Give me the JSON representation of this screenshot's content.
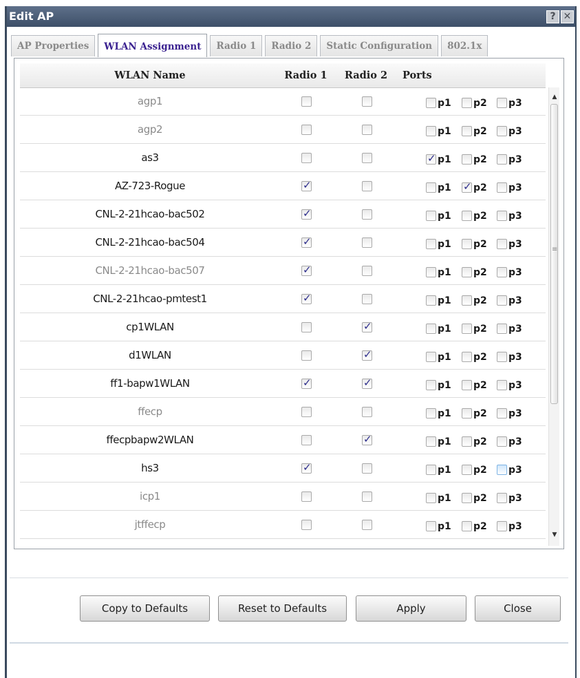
{
  "window": {
    "title": "Edit AP",
    "help_glyph": "?",
    "close_glyph": "✕"
  },
  "tabs": [
    {
      "label": "AP Properties",
      "active": false
    },
    {
      "label": "WLAN Assignment",
      "active": true
    },
    {
      "label": "Radio 1",
      "active": false
    },
    {
      "label": "Radio 2",
      "active": false
    },
    {
      "label": "Static Configuration",
      "active": false
    },
    {
      "label": "802.1x",
      "active": false
    }
  ],
  "grid": {
    "columns": {
      "wlan_name": "WLAN Name",
      "radio1": "Radio 1",
      "radio2": "Radio 2",
      "ports": "Ports"
    },
    "port_labels": [
      "p1",
      "p2",
      "p3"
    ],
    "rows": [
      {
        "name": "agp1",
        "dim": true,
        "radio1": false,
        "radio2": false,
        "ports": [
          false,
          false,
          false
        ]
      },
      {
        "name": "agp2",
        "dim": true,
        "radio1": false,
        "radio2": false,
        "ports": [
          false,
          false,
          false
        ]
      },
      {
        "name": "as3",
        "dim": false,
        "radio1": false,
        "radio2": false,
        "ports": [
          true,
          false,
          false
        ]
      },
      {
        "name": "AZ-723-Rogue",
        "dim": false,
        "radio1": true,
        "radio2": false,
        "ports": [
          false,
          true,
          false
        ]
      },
      {
        "name": "CNL-2-21hcao-bac502",
        "dim": false,
        "radio1": true,
        "radio2": false,
        "ports": [
          false,
          false,
          false
        ]
      },
      {
        "name": "CNL-2-21hcao-bac504",
        "dim": false,
        "radio1": true,
        "radio2": false,
        "ports": [
          false,
          false,
          false
        ]
      },
      {
        "name": "CNL-2-21hcao-bac507",
        "dim": true,
        "radio1": true,
        "radio2": false,
        "ports": [
          false,
          false,
          false
        ]
      },
      {
        "name": "CNL-2-21hcao-pmtest1",
        "dim": false,
        "radio1": true,
        "radio2": false,
        "ports": [
          false,
          false,
          false
        ]
      },
      {
        "name": "cp1WLAN",
        "dim": false,
        "radio1": false,
        "radio2": true,
        "ports": [
          false,
          false,
          false
        ]
      },
      {
        "name": "d1WLAN",
        "dim": false,
        "radio1": false,
        "radio2": true,
        "ports": [
          false,
          false,
          false
        ]
      },
      {
        "name": "ff1-bapw1WLAN",
        "dim": false,
        "radio1": true,
        "radio2": true,
        "ports": [
          false,
          false,
          false
        ]
      },
      {
        "name": "ffecp",
        "dim": true,
        "radio1": false,
        "radio2": false,
        "ports": [
          false,
          false,
          false
        ]
      },
      {
        "name": "ffecpbapw2WLAN",
        "dim": false,
        "radio1": false,
        "radio2": true,
        "ports": [
          false,
          false,
          false
        ]
      },
      {
        "name": "hs3",
        "dim": false,
        "radio1": true,
        "radio2": false,
        "ports": [
          false,
          false,
          false
        ],
        "hover_port": 2
      },
      {
        "name": "icp1",
        "dim": true,
        "radio1": false,
        "radio2": false,
        "ports": [
          false,
          false,
          false
        ]
      },
      {
        "name": "jtffecp",
        "dim": true,
        "radio1": false,
        "radio2": false,
        "ports": [
          false,
          false,
          false
        ]
      }
    ]
  },
  "buttons": {
    "copy": "Copy to Defaults",
    "reset": "Reset to Defaults",
    "apply": "Apply",
    "close": "Close"
  }
}
